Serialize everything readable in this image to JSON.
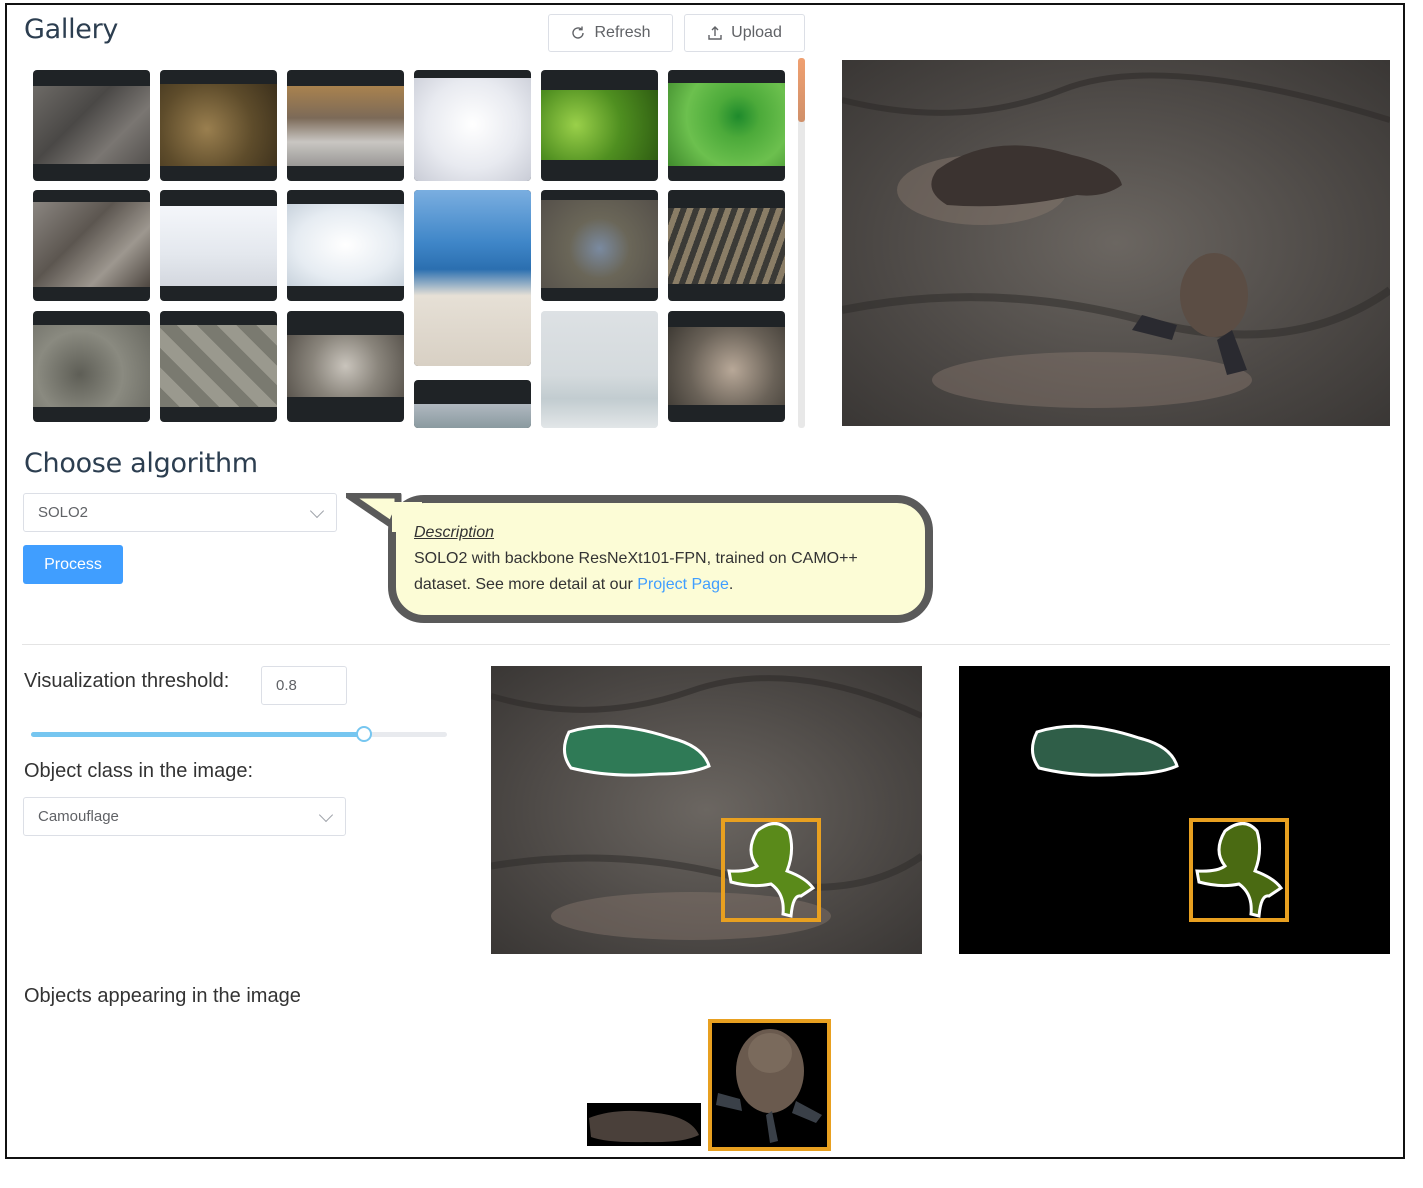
{
  "gallery": {
    "title": "Gallery"
  },
  "toolbar": {
    "refresh_label": "Refresh",
    "upload_label": "Upload"
  },
  "algorithm": {
    "title": "Choose algorithm",
    "selected": "SOLO2",
    "process_label": "Process",
    "description_heading": "Description",
    "description_text": "SOLO2 with backbone ResNeXt101-FPN, trained on CAMO++ dataset. See more detail at our ",
    "description_link": "Project Page",
    "description_end": "."
  },
  "visualization": {
    "threshold_label": "Visualization threshold:",
    "threshold_value": "0.8",
    "slider_fraction": 0.8,
    "class_label": "Object class in the image:",
    "class_selected": "Camouflage"
  },
  "objects": {
    "title": "Objects appearing in the image"
  },
  "colors": {
    "accent": "#409eff",
    "highlight": "#e8a020",
    "mask1": "#2f7a56",
    "mask2": "#5a8a1a"
  }
}
